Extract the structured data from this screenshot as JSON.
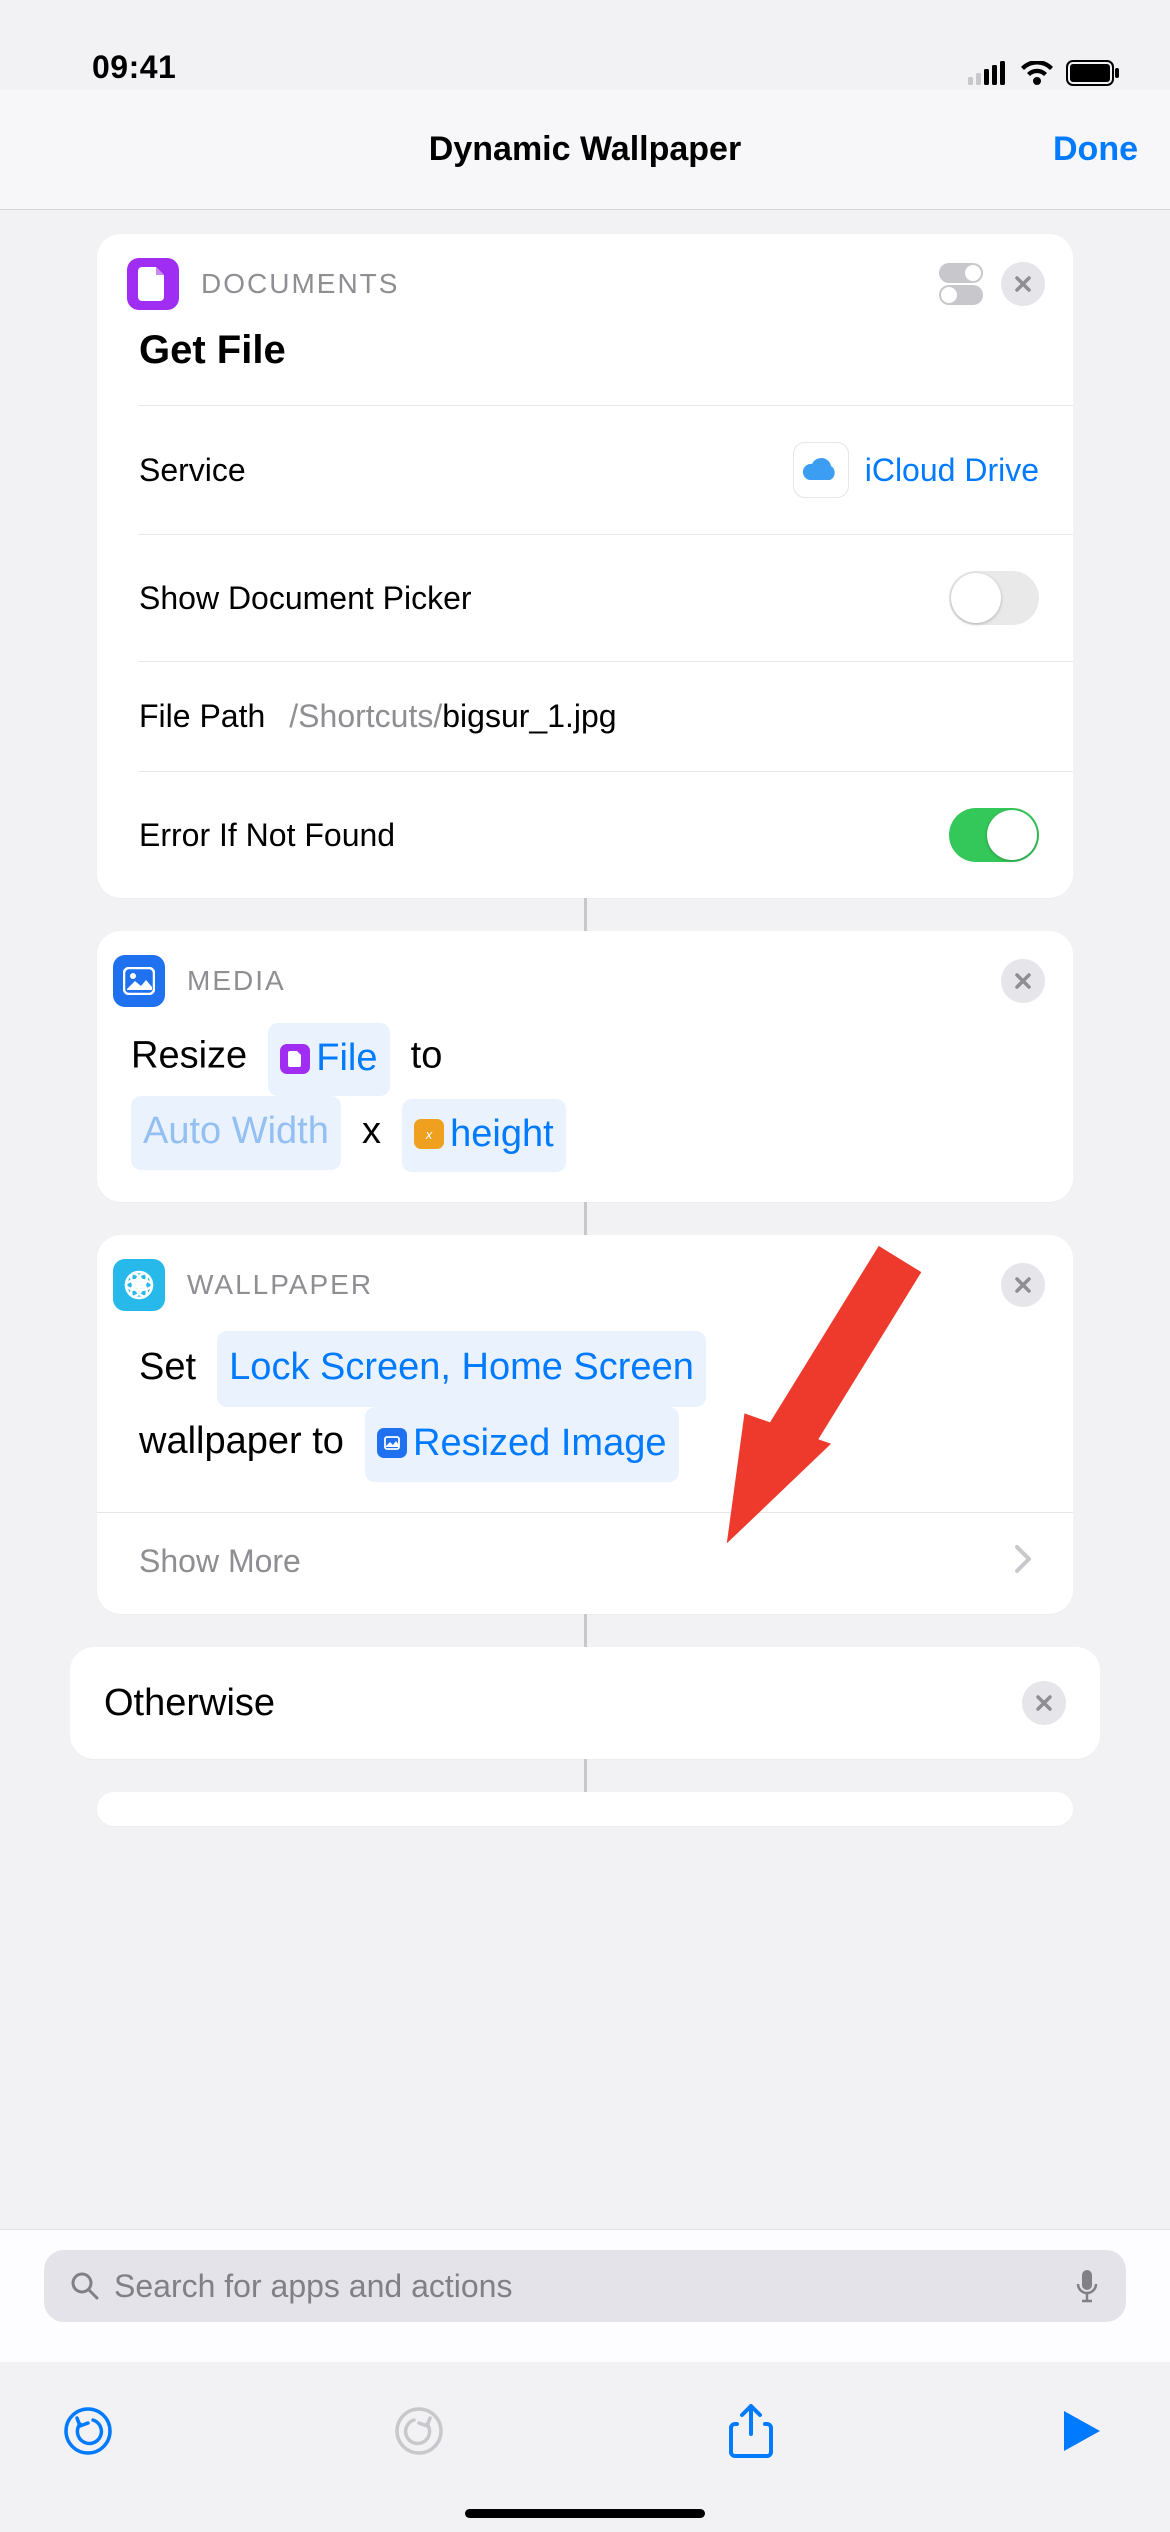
{
  "status": {
    "time": "09:41"
  },
  "nav": {
    "title": "Dynamic Wallpaper",
    "done": "Done"
  },
  "card_documents": {
    "category": "DOCUMENTS",
    "title": "Get File",
    "service_label": "Service",
    "service_value": "iCloud Drive",
    "picker_label": "Show Document Picker",
    "filepath_label": "File Path",
    "filepath_prefix": "/Shortcuts/",
    "filepath_file": "bigsur_1.jpg",
    "error_label": "Error If Not Found"
  },
  "card_media": {
    "category": "MEDIA",
    "resize_word": "Resize",
    "file_token": "File",
    "to_word": "to",
    "auto_width": "Auto Width",
    "x_word": "x",
    "height_token": "height"
  },
  "card_wallpaper": {
    "category": "WALLPAPER",
    "set_word": "Set",
    "screens_token": "Lock Screen, Home Screen",
    "wallpaper_word": "wallpaper to",
    "resized_token": "Resized Image",
    "show_more": "Show More"
  },
  "card_otherwise": {
    "label": "Otherwise"
  },
  "search": {
    "placeholder": "Search for apps and actions"
  }
}
